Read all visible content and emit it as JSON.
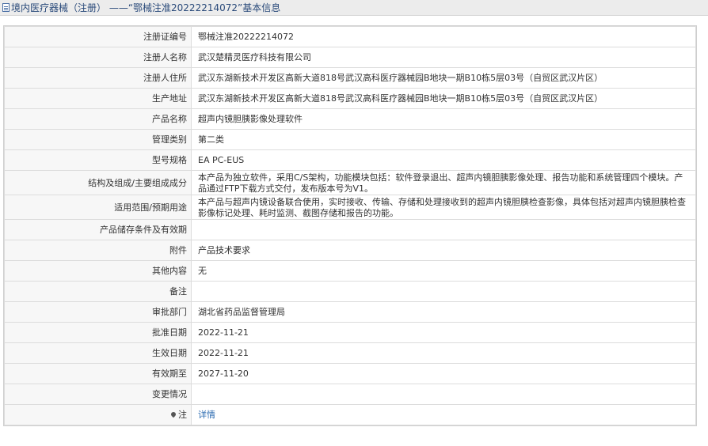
{
  "header": {
    "title": "境内医疗器械（注册） ——“鄂械注准20222214072”基本信息"
  },
  "rows": [
    {
      "label": "注册证编号",
      "value": "鄂械注准20222214072"
    },
    {
      "label": "注册人名称",
      "value": "武汉楚精灵医疗科技有限公司"
    },
    {
      "label": "注册人住所",
      "value": "武汉东湖新技术开发区高新大道818号武汉高科医疗器械园B地块一期B10栋5层03号（自贸区武汉片区）"
    },
    {
      "label": "生产地址",
      "value": "武汉东湖新技术开发区高新大道818号武汉高科医疗器械园B地块一期B10栋5层03号（自贸区武汉片区）"
    },
    {
      "label": "产品名称",
      "value": "超声内镜胆胰影像处理软件"
    },
    {
      "label": "管理类别",
      "value": "第二类"
    },
    {
      "label": "型号规格",
      "value": "EA PC-EUS"
    },
    {
      "label": "结构及组成/主要组成成分",
      "value": "本产品为独立软件，采用C/S架构，功能模块包括：软件登录退出、超声内镜胆胰影像处理、报告功能和系统管理四个模块。产品通过FTP下载方式交付，发布版本号为V1。"
    },
    {
      "label": "适用范围/预期用途",
      "value": "本产品与超声内镜设备联合使用，实时接收、传输、存储和处理接收到的超声内镜胆胰检查影像，具体包括对超声内镜胆胰检查影像标记处理、耗时监测、截图存储和报告的功能。"
    },
    {
      "label": "产品储存条件及有效期",
      "value": ""
    },
    {
      "label": "附件",
      "value": "产品技术要求"
    },
    {
      "label": "其他内容",
      "value": "无"
    },
    {
      "label": "备注",
      "value": ""
    },
    {
      "label": "审批部门",
      "value": "湖北省药品监督管理局"
    },
    {
      "label": "批准日期",
      "value": "2022-11-21"
    },
    {
      "label": "生效日期",
      "value": "2022-11-21"
    },
    {
      "label": "有效期至",
      "value": "2027-11-20"
    },
    {
      "label": "变更情况",
      "value": ""
    }
  ],
  "note": {
    "label": "注",
    "icon": "pin-icon",
    "link": "详情"
  },
  "colors": {
    "header_bg": "#ececec",
    "label_bg": "#f7f7f7",
    "border": "#dcdcdc",
    "link": "#2a6ab0"
  }
}
